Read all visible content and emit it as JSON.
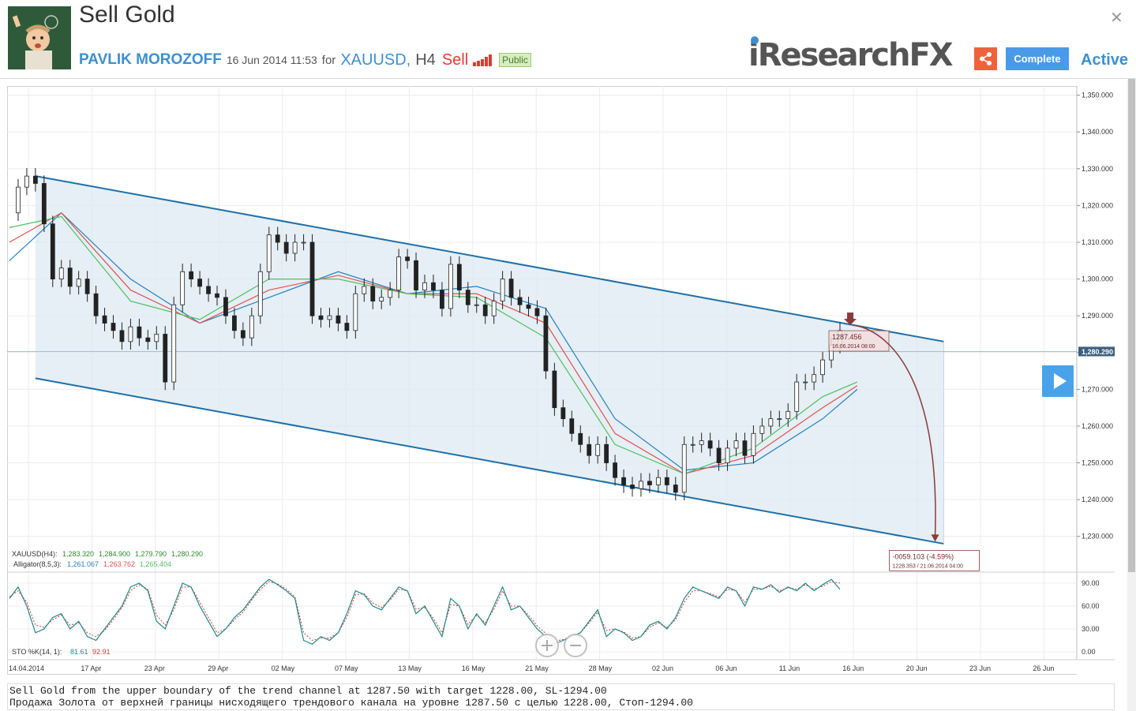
{
  "header": {
    "title": "Sell Gold",
    "author": "PAVLIK MOROZOFF",
    "date": "16 Jun 2014 11:53",
    "for_label": "for",
    "symbol": "XAUUSD",
    "timeframe": "H4",
    "direction": "Sell",
    "visibility": "Public",
    "close_icon": "close-icon",
    "logo_text": "iResearchFX",
    "share_icon": "share-icon",
    "complete_label": "Complete",
    "status": "Active"
  },
  "colors": {
    "accent": "#3d8fcf",
    "sell": "#e53935",
    "channel_line": "#1f6fa6",
    "channel_fill": "#dce9f2",
    "jaw": "#2a7fc4",
    "teeth": "#e05050",
    "lips": "#4fbf5f",
    "stoch": "#1f8a8a",
    "stoch_signal": "#e03030",
    "arrow": "#8b3a3a"
  },
  "chart_data": {
    "type": "line",
    "symbol": "XAUUSD",
    "timeframe": "H4",
    "x_ticks": [
      "14.04.2014",
      "17 Apr",
      "23 Apr",
      "29 Apr",
      "02 May",
      "07 May",
      "13 May",
      "16 May",
      "21 May",
      "28 May",
      "02 Jun",
      "06 Jun",
      "11 Jun",
      "16 Jun",
      "20 Jun",
      "23 Jun",
      "26 Jun"
    ],
    "y_ticks": [
      "1,350.000",
      "1,340.000",
      "1,330.000",
      "1,320.000",
      "1,310.000",
      "1,300.000",
      "1,290.000",
      "1,280.000",
      "1,270.000",
      "1,260.000",
      "1,250.000",
      "1,240.000",
      "1,230.000"
    ],
    "y_tick_values": [
      1350,
      1340,
      1330,
      1320,
      1310,
      1300,
      1290,
      1280,
      1270,
      1260,
      1250,
      1240,
      1230
    ],
    "ylim": [
      1220.5,
      1352.5
    ],
    "current_price_label": "1,280.290",
    "current_price": 1280.29,
    "price_path": [
      [
        0,
        1318
      ],
      [
        1,
        1325
      ],
      [
        2,
        1328
      ],
      [
        3,
        1326
      ],
      [
        4,
        1315
      ],
      [
        5,
        1300
      ],
      [
        6,
        1303
      ],
      [
        7,
        1298
      ],
      [
        8,
        1300
      ],
      [
        9,
        1296
      ],
      [
        10,
        1290
      ],
      [
        11,
        1288
      ],
      [
        12,
        1286
      ],
      [
        13,
        1283
      ],
      [
        14,
        1287
      ],
      [
        15,
        1284
      ],
      [
        16,
        1283
      ],
      [
        17,
        1285
      ],
      [
        18,
        1272
      ],
      [
        19,
        1293
      ],
      [
        20,
        1302
      ],
      [
        21,
        1300
      ],
      [
        22,
        1298
      ],
      [
        23,
        1296
      ],
      [
        24,
        1295
      ],
      [
        25,
        1290
      ],
      [
        26,
        1286
      ],
      [
        27,
        1284
      ],
      [
        28,
        1290
      ],
      [
        29,
        1302
      ],
      [
        30,
        1312
      ],
      [
        31,
        1310
      ],
      [
        32,
        1307
      ],
      [
        33,
        1310
      ],
      [
        34,
        1310
      ],
      [
        35,
        1290
      ],
      [
        36,
        1289
      ],
      [
        37,
        1290
      ],
      [
        38,
        1288
      ],
      [
        39,
        1286
      ],
      [
        40,
        1296
      ],
      [
        41,
        1298
      ],
      [
        42,
        1294
      ],
      [
        43,
        1295
      ],
      [
        44,
        1297
      ],
      [
        45,
        1306
      ],
      [
        46,
        1305
      ],
      [
        47,
        1297
      ],
      [
        48,
        1299
      ],
      [
        49,
        1297
      ],
      [
        50,
        1292
      ],
      [
        51,
        1304
      ],
      [
        52,
        1297
      ],
      [
        53,
        1293
      ],
      [
        54,
        1293
      ],
      [
        55,
        1290
      ],
      [
        56,
        1294
      ],
      [
        57,
        1300
      ],
      [
        58,
        1295
      ],
      [
        59,
        1293
      ],
      [
        60,
        1292
      ],
      [
        61,
        1290
      ],
      [
        62,
        1275
      ],
      [
        63,
        1265
      ],
      [
        64,
        1262
      ],
      [
        65,
        1258
      ],
      [
        66,
        1255
      ],
      [
        67,
        1252
      ],
      [
        68,
        1255
      ],
      [
        69,
        1250
      ],
      [
        70,
        1246
      ],
      [
        71,
        1244
      ],
      [
        72,
        1243
      ],
      [
        73,
        1245
      ],
      [
        74,
        1244
      ],
      [
        75,
        1246
      ],
      [
        76,
        1244
      ],
      [
        77,
        1242
      ],
      [
        78,
        1255
      ],
      [
        79,
        1255
      ],
      [
        80,
        1256
      ],
      [
        81,
        1254
      ],
      [
        82,
        1250
      ],
      [
        83,
        1254
      ],
      [
        84,
        1256
      ],
      [
        85,
        1252
      ],
      [
        86,
        1258
      ],
      [
        87,
        1260
      ],
      [
        88,
        1262
      ],
      [
        89,
        1262
      ],
      [
        90,
        1264
      ],
      [
        91,
        1272
      ],
      [
        92,
        1272
      ],
      [
        93,
        1274
      ],
      [
        94,
        1278
      ],
      [
        95,
        1282
      ],
      [
        96,
        1286
      ]
    ],
    "price_x_range": [
      0,
      96
    ],
    "plot_x_fraction": [
      0.001,
      0.775
    ],
    "alligator": {
      "jaw": [
        [
          0,
          1305
        ],
        [
          6,
          1318
        ],
        [
          14,
          1300
        ],
        [
          22,
          1288
        ],
        [
          30,
          1295
        ],
        [
          38,
          1302
        ],
        [
          46,
          1296
        ],
        [
          54,
          1298
        ],
        [
          62,
          1292
        ],
        [
          70,
          1262
        ],
        [
          78,
          1248
        ],
        [
          86,
          1250
        ],
        [
          94,
          1262
        ],
        [
          98,
          1270
        ]
      ],
      "teeth": [
        [
          0,
          1310
        ],
        [
          6,
          1318
        ],
        [
          14,
          1297
        ],
        [
          22,
          1288
        ],
        [
          30,
          1297
        ],
        [
          38,
          1301
        ],
        [
          46,
          1296
        ],
        [
          54,
          1296
        ],
        [
          62,
          1288
        ],
        [
          70,
          1258
        ],
        [
          78,
          1247
        ],
        [
          86,
          1252
        ],
        [
          94,
          1265
        ],
        [
          98,
          1271
        ]
      ],
      "lips": [
        [
          0,
          1314
        ],
        [
          6,
          1317
        ],
        [
          14,
          1294
        ],
        [
          22,
          1289
        ],
        [
          30,
          1300
        ],
        [
          38,
          1300
        ],
        [
          46,
          1296
        ],
        [
          54,
          1295
        ],
        [
          62,
          1284
        ],
        [
          70,
          1255
        ],
        [
          78,
          1247
        ],
        [
          86,
          1254
        ],
        [
          94,
          1268
        ],
        [
          98,
          1272
        ]
      ]
    },
    "channel": {
      "upper": [
        [
          3,
          1328
        ],
        [
          108,
          1283
        ]
      ],
      "lower": [
        [
          3,
          1273
        ],
        [
          108,
          1228
        ]
      ]
    },
    "entry": {
      "price_label": "1287.456",
      "date_label": "16.06.2014 08:00",
      "x": 96,
      "price": 1287.456
    },
    "target": {
      "change_label": "-0059.103 (-4.59%)",
      "detail_label": "1228.353 / 21.06.2014 04:00",
      "x": 107,
      "price": 1228.353
    },
    "legend": {
      "ohlc_name": "XAUUSD(H4):",
      "ohlc_values": [
        "1,283.320",
        "1,284.900",
        "1,279.790",
        "1,280.290"
      ],
      "alligator_name": "Alligator(8,5,3):",
      "alligator_values": [
        "1,261.067",
        "1,263.762",
        "1,265.404"
      ],
      "stoch_name": "STO %K(14, 1):",
      "stoch_values": [
        "81.61",
        "92.91"
      ]
    },
    "stochastic": {
      "y_ticks": [
        "90.00",
        "60.00",
        "30.00",
        "0.00"
      ],
      "y_tick_values": [
        90,
        60,
        30,
        0
      ],
      "k": [
        70,
        85,
        60,
        25,
        30,
        45,
        50,
        30,
        40,
        20,
        15,
        30,
        45,
        60,
        85,
        90,
        80,
        40,
        30,
        60,
        90,
        85,
        60,
        40,
        20,
        30,
        45,
        55,
        70,
        85,
        95,
        88,
        80,
        70,
        15,
        10,
        20,
        15,
        25,
        50,
        80,
        75,
        60,
        55,
        70,
        85,
        80,
        50,
        60,
        40,
        20,
        70,
        60,
        30,
        50,
        35,
        60,
        85,
        55,
        60,
        45,
        30,
        20,
        10,
        15,
        20,
        25,
        40,
        55,
        20,
        30,
        25,
        15,
        20,
        35,
        40,
        30,
        45,
        70,
        85,
        80,
        75,
        70,
        85,
        80,
        60,
        85,
        82,
        88,
        78,
        85,
        80,
        90,
        80,
        88,
        95,
        82
      ],
      "d": [
        72,
        80,
        65,
        35,
        32,
        42,
        48,
        35,
        38,
        25,
        20,
        28,
        42,
        58,
        80,
        88,
        82,
        48,
        35,
        55,
        85,
        85,
        65,
        45,
        25,
        30,
        42,
        52,
        68,
        82,
        92,
        89,
        82,
        72,
        25,
        15,
        18,
        18,
        25,
        45,
        75,
        76,
        64,
        58,
        68,
        82,
        80,
        56,
        58,
        44,
        25,
        62,
        60,
        36,
        48,
        38,
        56,
        80,
        60,
        60,
        48,
        34,
        24,
        14,
        16,
        20,
        25,
        38,
        52,
        28,
        30,
        26,
        18,
        20,
        32,
        38,
        32,
        42,
        65,
        80,
        80,
        76,
        72,
        82,
        80,
        65,
        82,
        82,
        86,
        80,
        84,
        82,
        88,
        82,
        86,
        92,
        90
      ]
    }
  },
  "description": {
    "line_en": "Sell Gold from the upper boundary of the trend channel at 1287.50 with target 1228.00, SL-1294.00",
    "line_ru": "Продажа Золота от верхней границы нисходящего трендового канала на уровне 1287.50 с целью 1228.00, Стоп-1294.00"
  }
}
